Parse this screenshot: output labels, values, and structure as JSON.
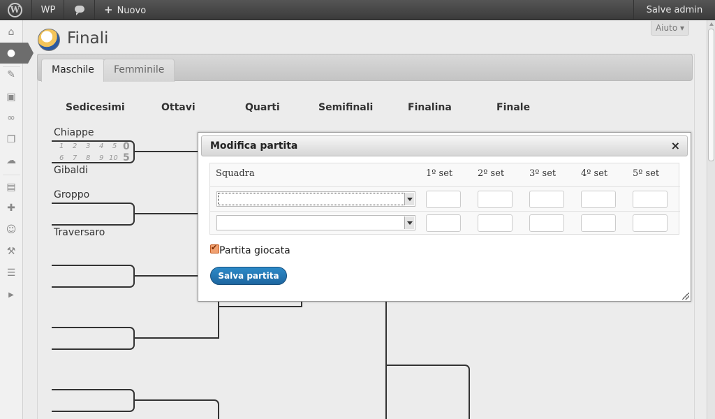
{
  "adminbar": {
    "site_label": "WP",
    "new_label": "Nuovo",
    "account_label": "Salve admin"
  },
  "page": {
    "title": "Finali",
    "help_label": "Aiuto ▾"
  },
  "tabs": [
    {
      "label": "Maschile",
      "active": true
    },
    {
      "label": "Femminile",
      "active": false
    }
  ],
  "rounds": [
    "Sedicesimi",
    "Ottavi",
    "Quarti",
    "Semifinali",
    "Finalina",
    "Finale"
  ],
  "bracket": {
    "teams": [
      "Chiappe",
      "Gibaldi",
      "Groppo",
      "Traversaro"
    ],
    "match1": {
      "sets_top": [
        "1",
        "2",
        "3",
        "4",
        "5"
      ],
      "sets_bottom": [
        "6",
        "7",
        "8",
        "9",
        "10"
      ],
      "score_top": "0",
      "score_bottom": "5"
    }
  },
  "dialog": {
    "title": "Modifica partita",
    "close_glyph": "×",
    "columns": [
      "Squadra",
      "1º set",
      "2º set",
      "3º set",
      "4º set",
      "5º set"
    ],
    "played_label": "Partita giocata",
    "played": true,
    "save_label": "Salva partita"
  },
  "menu_icons": [
    "dashboard-icon",
    "volleyball-icon",
    "pin-icon",
    "media-icon",
    "links-icon",
    "pages-icon",
    "comments-icon",
    "appearance-icon",
    "plugins-icon",
    "users-icon",
    "tools-icon",
    "settings-icon",
    "collapse-icon"
  ]
}
